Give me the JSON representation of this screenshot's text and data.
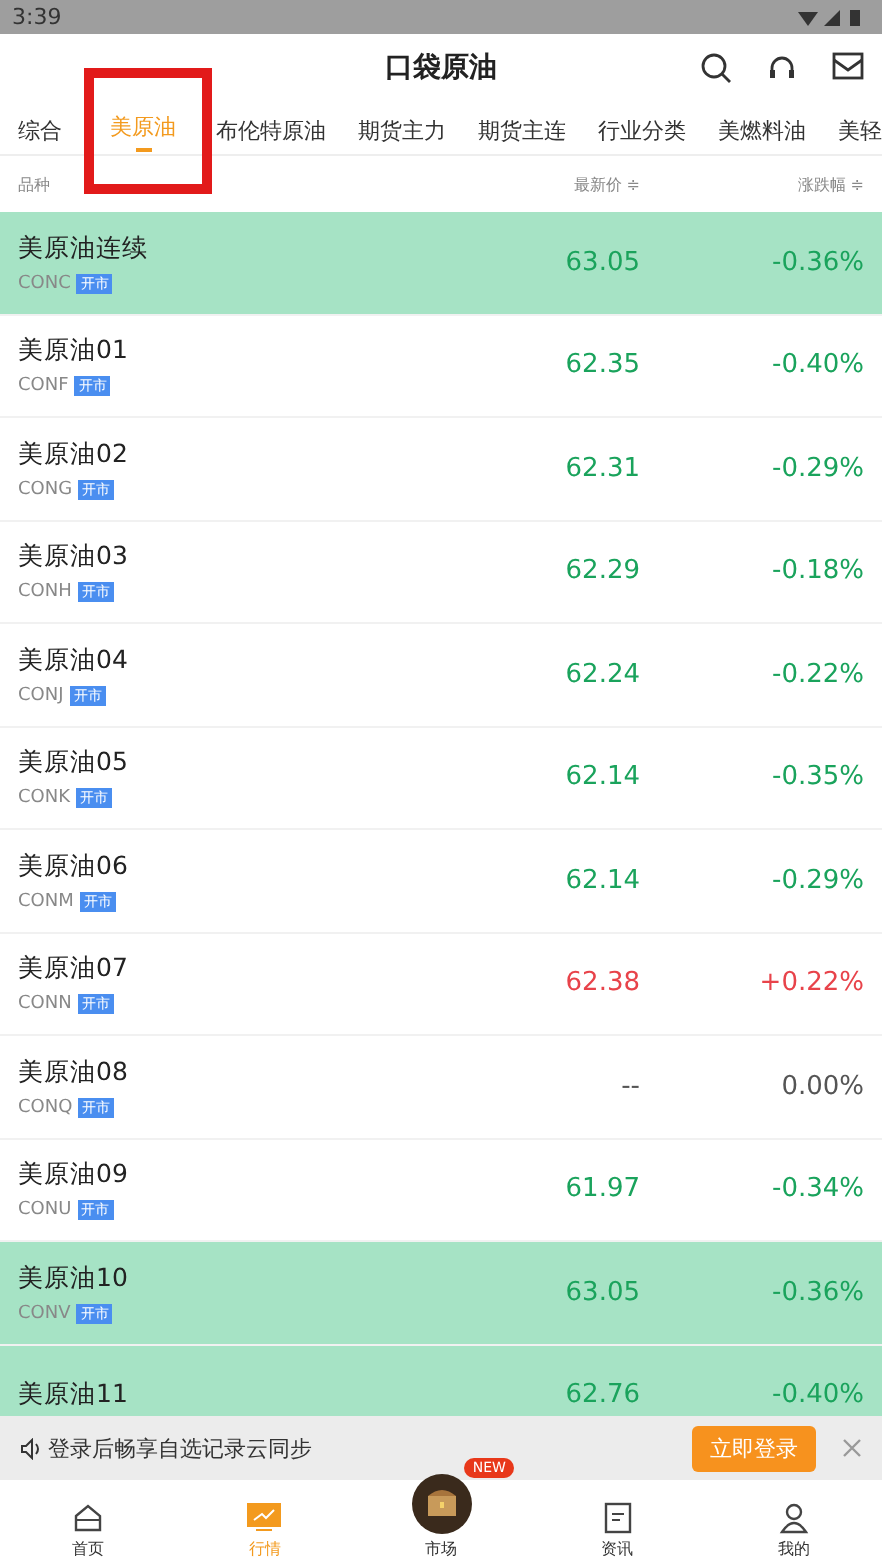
{
  "status_bar": {
    "time": "3:39"
  },
  "header": {
    "title": "口袋原油"
  },
  "tabs": [
    {
      "label": "综合",
      "selected": false
    },
    {
      "label": "美原油",
      "selected": true
    },
    {
      "label": "布伦特原油",
      "selected": false
    },
    {
      "label": "期货主力",
      "selected": false
    },
    {
      "label": "期货主连",
      "selected": false
    },
    {
      "label": "行业分类",
      "selected": false
    },
    {
      "label": "美燃料油",
      "selected": false
    },
    {
      "label": "美轻",
      "selected": false
    }
  ],
  "columns": {
    "name": "品种",
    "price": "最新价 ≑",
    "change": "涨跌幅 ≑"
  },
  "rows": [
    {
      "name": "美原油连续",
      "code": "CONC",
      "badge": "开市",
      "price": "63.05",
      "change": "-0.36%",
      "color": "#1aa35c",
      "highlighted": true
    },
    {
      "name": "美原油01",
      "code": "CONF",
      "badge": "开市",
      "price": "62.35",
      "change": "-0.40%",
      "color": "#1aa35c",
      "highlighted": false
    },
    {
      "name": "美原油02",
      "code": "CONG",
      "badge": "开市",
      "price": "62.31",
      "change": "-0.29%",
      "color": "#1aa35c",
      "highlighted": false
    },
    {
      "name": "美原油03",
      "code": "CONH",
      "badge": "开市",
      "price": "62.29",
      "change": "-0.18%",
      "color": "#1aa35c",
      "highlighted": false
    },
    {
      "name": "美原油04",
      "code": "CONJ",
      "badge": "开市",
      "price": "62.24",
      "change": "-0.22%",
      "color": "#1aa35c",
      "highlighted": false
    },
    {
      "name": "美原油05",
      "code": "CONK",
      "badge": "开市",
      "price": "62.14",
      "change": "-0.35%",
      "color": "#1aa35c",
      "highlighted": false
    },
    {
      "name": "美原油06",
      "code": "CONM",
      "badge": "开市",
      "price": "62.14",
      "change": "-0.29%",
      "color": "#1aa35c",
      "highlighted": false
    },
    {
      "name": "美原油07",
      "code": "CONN",
      "badge": "开市",
      "price": "62.38",
      "change": "+0.22%",
      "color": "#e8434a",
      "highlighted": false
    },
    {
      "name": "美原油08",
      "code": "CONQ",
      "badge": "开市",
      "price": "--",
      "change": "0.00%",
      "color": "#555555",
      "highlighted": false
    },
    {
      "name": "美原油09",
      "code": "CONU",
      "badge": "开市",
      "price": "61.97",
      "change": "-0.34%",
      "color": "#1aa35c",
      "highlighted": false
    },
    {
      "name": "美原油10",
      "code": "CONV",
      "badge": "开市",
      "price": "63.05",
      "change": "-0.36%",
      "color": "#1aa35c",
      "highlighted": true
    },
    {
      "name": "美原油11",
      "price": "62.76",
      "change": "-0.40%",
      "color": "#1aa35c",
      "highlighted": true
    }
  ],
  "login_banner": {
    "text": "登录后畅享自选记录云同步",
    "button": "立即登录"
  },
  "bottom_nav": [
    {
      "label": "首页",
      "kind": "home",
      "selected": false
    },
    {
      "label": "行情",
      "kind": "quotes",
      "selected": true
    },
    {
      "label": "市场",
      "kind": "market",
      "selected": false,
      "badge": "NEW"
    },
    {
      "label": "资讯",
      "kind": "news",
      "selected": false
    },
    {
      "label": "我的",
      "kind": "profile",
      "selected": false
    }
  ]
}
